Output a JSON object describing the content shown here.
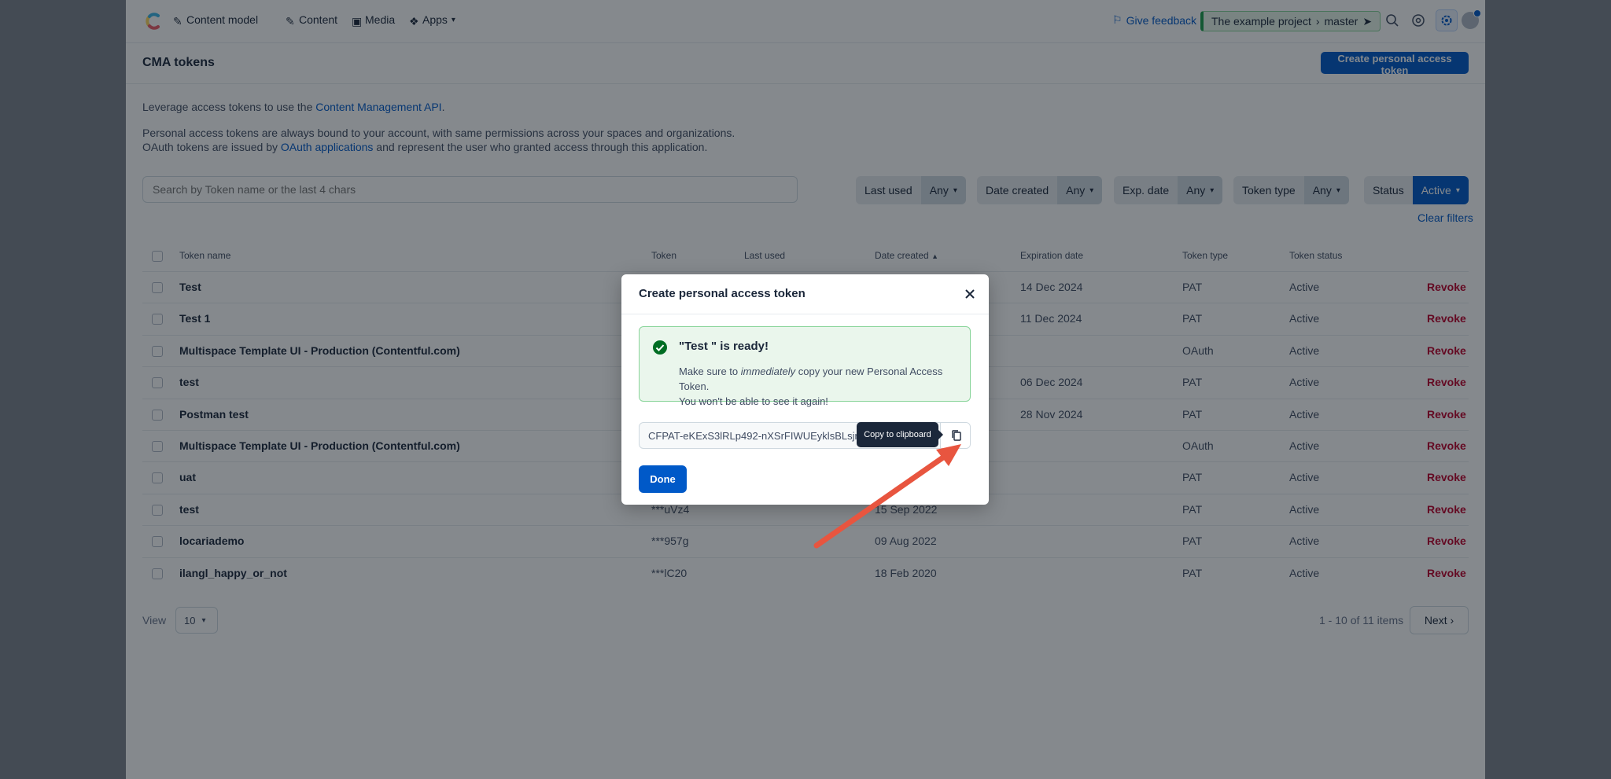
{
  "nav": {
    "items": [
      {
        "label": "Content model",
        "icon": "wrench-icon"
      },
      {
        "label": "Content",
        "icon": "pencil-icon"
      },
      {
        "label": "Media",
        "icon": "image-icon"
      },
      {
        "label": "Apps",
        "icon": "apps-icon"
      }
    ],
    "feedback": "Give feedback",
    "project": "The example project",
    "environment": "master"
  },
  "page": {
    "title": "CMA tokens",
    "create_button": "Create personal access token",
    "desc1_pre": "Leverage access tokens to use the ",
    "desc1_link": "Content Management API",
    "desc1_post": ".",
    "desc2": "Personal access tokens are always bound to your account, with same permissions across your spaces and organizations.",
    "desc3_pre": "OAuth tokens are issued by ",
    "desc3_link": "OAuth applications",
    "desc3_post": " and represent the user who granted access through this application."
  },
  "filters": {
    "search_placeholder": "Search by Token name or the last 4 chars",
    "last_used": {
      "label": "Last used",
      "value": "Any"
    },
    "date_created": {
      "label": "Date created",
      "value": "Any"
    },
    "exp_date": {
      "label": "Exp. date",
      "value": "Any"
    },
    "token_type": {
      "label": "Token type",
      "value": "Any"
    },
    "status": {
      "label": "Status",
      "value": "Active"
    },
    "clear": "Clear filters"
  },
  "table": {
    "headers": {
      "name": "Token name",
      "token": "Token",
      "last_used": "Last used",
      "date_created": "Date created",
      "expiration": "Expiration date",
      "type": "Token type",
      "status": "Token status"
    },
    "revoke_label": "Revoke",
    "rows": [
      {
        "name": "Test",
        "token": "",
        "created": "",
        "expires": "14 Dec 2024",
        "type": "PAT",
        "status": "Active"
      },
      {
        "name": "Test 1",
        "token": "",
        "created": "",
        "expires": "11 Dec 2024",
        "type": "PAT",
        "status": "Active"
      },
      {
        "name": "Multispace Template UI - Production (Contentful.com)",
        "token": "",
        "created": "",
        "expires": "",
        "type": "OAuth",
        "status": "Active"
      },
      {
        "name": "test",
        "token": "",
        "created": "",
        "expires": "06 Dec 2024",
        "type": "PAT",
        "status": "Active"
      },
      {
        "name": "Postman test",
        "token": "",
        "created": "",
        "expires": "28 Nov 2024",
        "type": "PAT",
        "status": "Active"
      },
      {
        "name": "Multispace Template UI - Production (Contentful.com)",
        "token": "",
        "created": "",
        "expires": "",
        "type": "OAuth",
        "status": "Active"
      },
      {
        "name": "uat",
        "token": "",
        "created": "",
        "expires": "",
        "type": "PAT",
        "status": "Active"
      },
      {
        "name": "test",
        "token": "***uVz4",
        "created": "15 Sep 2022",
        "expires": "",
        "type": "PAT",
        "status": "Active"
      },
      {
        "name": "locariademo",
        "token": "***957g",
        "created": "09 Aug 2022",
        "expires": "",
        "type": "PAT",
        "status": "Active"
      },
      {
        "name": "ilangl_happy_or_not",
        "token": "***lC20",
        "created": "18 Feb 2020",
        "expires": "",
        "type": "PAT",
        "status": "Active"
      }
    ]
  },
  "pagination": {
    "view_label": "View",
    "view_value": "10",
    "items_text": "1 - 10 of 11 items",
    "next": "Next"
  },
  "modal": {
    "title": "Create personal access token",
    "note_title": "\"Test \" is ready!",
    "note_text_pre": "Make sure to ",
    "note_text_em": "immediately",
    "note_text_post": " copy your new Personal Access Token.",
    "note_text_line2": "You won't be able to see it again!",
    "token_value": "CFPAT-eKExS3lRLp492-nXSrFIWUEyklsBLsjmXDil",
    "tooltip": "Copy to clipboard",
    "done": "Done"
  },
  "colors": {
    "primary": "#0059c8",
    "success": "#1a9c4a",
    "danger": "#bd002a",
    "annotation_arrow": "#e8553f"
  }
}
